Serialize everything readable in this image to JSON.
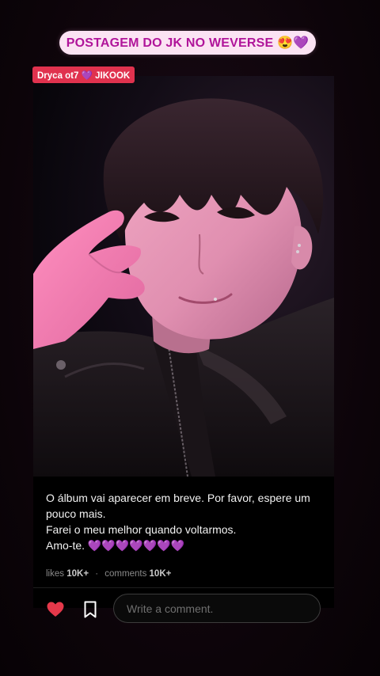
{
  "header": {
    "title": "POSTAGEM DO JK NO WEVERSE 😍💜",
    "watermark": "Dryca ot7 💜 JIKOOK"
  },
  "post": {
    "photo_icon": "selfie-photo",
    "caption_lines": [
      "O álbum vai aparecer em breve. Por favor, espere um pouco mais.",
      "Farei o meu melhor quando voltarmos.",
      "Amo-te. 💜💜💜💜💜💜💜"
    ],
    "likes_label": "likes",
    "likes_count": "10K+",
    "stats_separator": "·",
    "comments_label": "comments",
    "comments_count": "10K+"
  },
  "actions": {
    "like_icon": "heart-icon",
    "like_color": "#e5384a",
    "bookmark_icon": "bookmark-icon",
    "comment_placeholder": "Write a comment."
  },
  "colors": {
    "title_text": "#b0149a",
    "title_pill": "#fbe3f3",
    "watermark_bg": "#e0324e"
  }
}
